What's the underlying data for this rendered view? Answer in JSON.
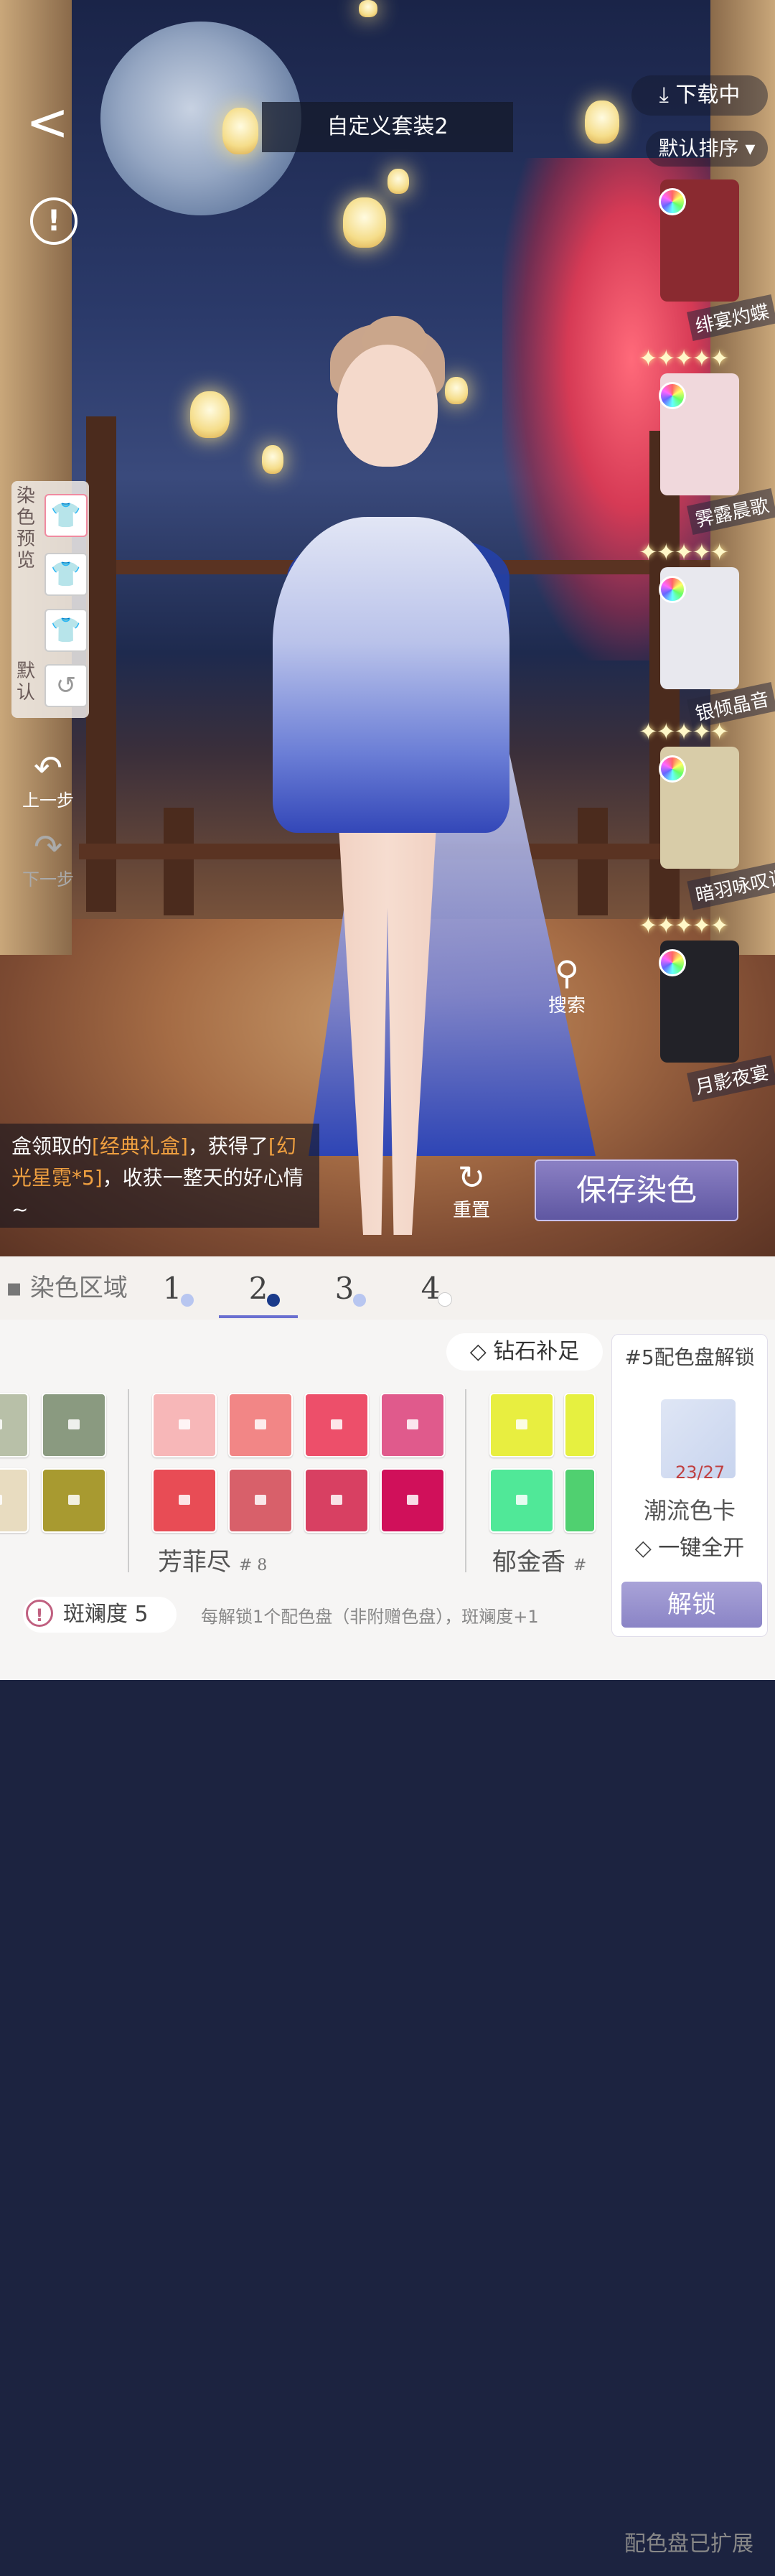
{
  "header": {
    "outfit_title": "自定义套装2",
    "download_label": "下载中",
    "sort_label": "默认排序 ▾"
  },
  "left_panel": {
    "dye_preview_label": "染色预览",
    "default_label": "默认",
    "undo_label": "上一步",
    "redo_label": "下一步"
  },
  "outfits": [
    {
      "name": "绯宴灼蝶",
      "color": "#8a2a30"
    },
    {
      "name": "霁露晨歌",
      "color": "#f0d8dc"
    },
    {
      "name": "银倾晶音",
      "color": "#e8e8ee"
    },
    {
      "name": "暗羽咏叹调",
      "color": "#d8cca8"
    },
    {
      "name": "月影夜宴",
      "color": "#222228"
    }
  ],
  "search_label": "搜索",
  "message": {
    "p1": "盒领取的",
    "h1": "[经典礼盒]",
    "p2": "，获得了",
    "h2": "[幻光星霓*5]",
    "p3": "，收获一整天的好心情~"
  },
  "reset_label": "重置",
  "save_label": "保存染色",
  "dye_tabs": {
    "label": "▪ 染色区域",
    "tabs": [
      {
        "num": "1",
        "dot": "#b8c6f0"
      },
      {
        "num": "2",
        "dot": "#1a3a8a"
      },
      {
        "num": "3",
        "dot": "#b8c6f0"
      },
      {
        "num": "4",
        "dot": "#ffffff"
      }
    ],
    "expanded": "配色盘已扩展"
  },
  "diamond_label": "钻石补足",
  "palettes": {
    "left_colors": [
      "#b8c0a8",
      "#8a9a80",
      "#e8dcc0",
      "#a89a30"
    ],
    "main_name": "芳菲尽",
    "main_num": "# 8",
    "main_colors": [
      "#f7b7b8",
      "#f28686",
      "#ed4f6a",
      "#e05a8c",
      "#e84c55",
      "#d8606a",
      "#d84062",
      "#d0105a"
    ],
    "right_name": "郁金香",
    "right_num": "#",
    "right_colors": [
      "#e8ee40",
      "#e6f040",
      "#50e898",
      "#50d070"
    ]
  },
  "unlock_card": {
    "title": "#5配色盘解锁",
    "count": "23/27",
    "name": "潮流色卡",
    "all": "一键全开",
    "button": "解锁"
  },
  "spot": {
    "label": "斑斓度 5",
    "note": "每解锁1个配色盘（非附赠色盘），斑斓度+1"
  }
}
